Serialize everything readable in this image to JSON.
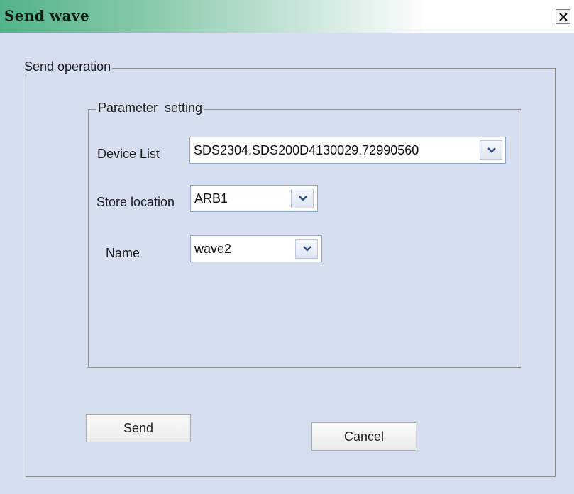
{
  "window": {
    "title": "Send wave",
    "close_icon": "close-icon"
  },
  "send_operation": {
    "legend": "Send operation"
  },
  "parameter_setting": {
    "legend": "Parameter  setting",
    "device_list": {
      "label": "Device List",
      "value": "SDS2304.SDS200D4130029.72990560"
    },
    "store_location": {
      "label": "Store location",
      "value": "ARB1"
    },
    "name": {
      "label": "Name",
      "value": "wave2"
    }
  },
  "buttons": {
    "send": "Send",
    "cancel": "Cancel"
  },
  "colors": {
    "background": "#d6dff0",
    "title_gradient_start": "#52b38a",
    "combo_border": "#8aa6c9"
  }
}
